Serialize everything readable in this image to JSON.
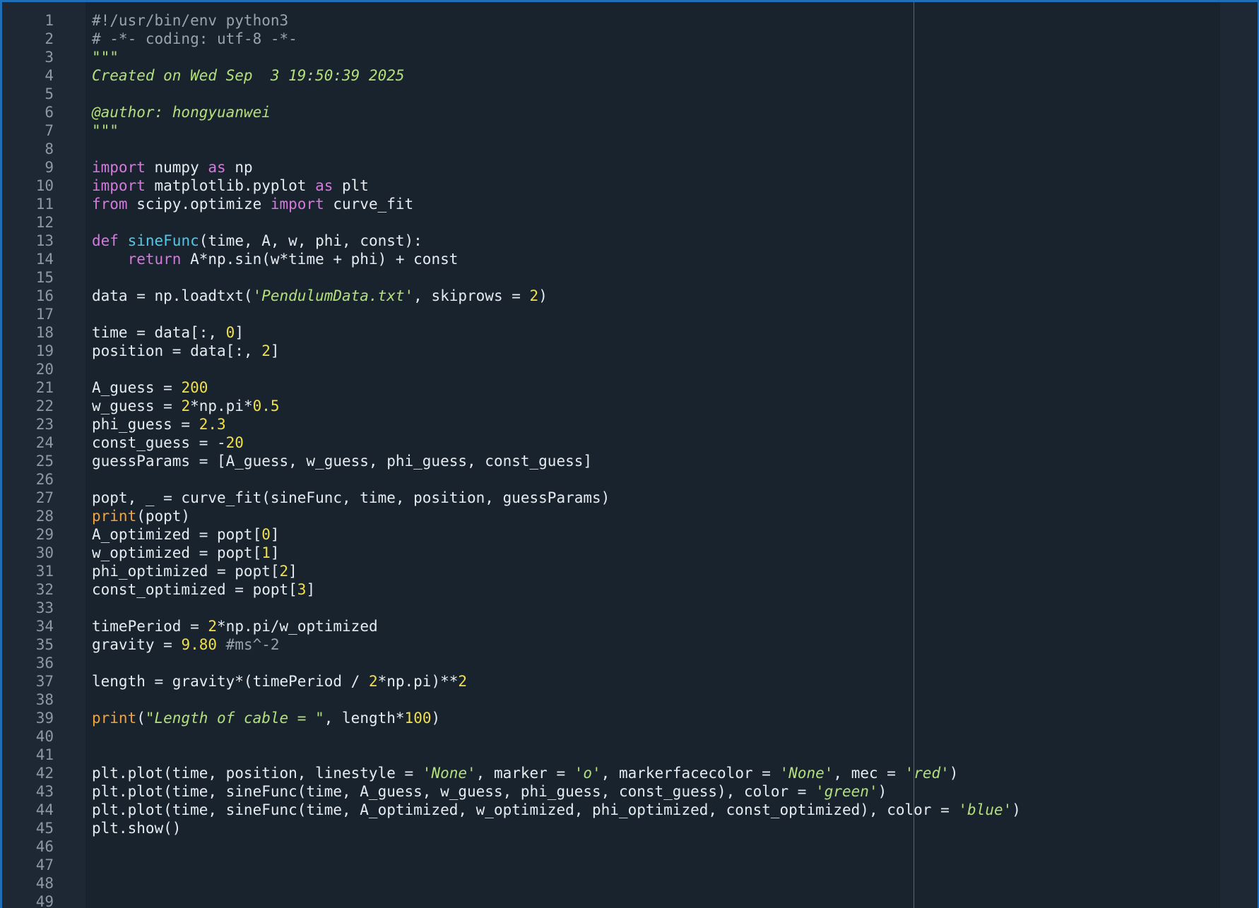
{
  "colors": {
    "background": "#19232e",
    "gutter": "#1d2834",
    "line_number": "#8e99a5",
    "text": "#e6ebf0",
    "comment": "#9aa3ad",
    "docstring": "#b3e07a",
    "keyword": "#d678dd",
    "function_name": "#52c8e8",
    "builtin": "#f4a23a",
    "number": "#f2e04b",
    "string": "#b3e07a",
    "border": "#1f6fb8",
    "edge_ruler": "#5c6670"
  },
  "lines": [
    {
      "n": "1",
      "tokens": [
        {
          "t": "comment",
          "v": "#!/usr/bin/env python3"
        }
      ]
    },
    {
      "n": "2",
      "tokens": [
        {
          "t": "comment",
          "v": "# -*- coding: utf-8 -*-"
        }
      ]
    },
    {
      "n": "3",
      "tokens": [
        {
          "t": "docstring",
          "v": "\"\"\""
        }
      ]
    },
    {
      "n": "4",
      "tokens": [
        {
          "t": "docstring",
          "v": "Created on Wed Sep  3 19:50:39 2025"
        }
      ]
    },
    {
      "n": "5",
      "tokens": []
    },
    {
      "n": "6",
      "tokens": [
        {
          "t": "docstring",
          "v": "@author: hongyuanwei"
        }
      ]
    },
    {
      "n": "7",
      "tokens": [
        {
          "t": "docstring",
          "v": "\"\"\""
        }
      ]
    },
    {
      "n": "8",
      "tokens": []
    },
    {
      "n": "9",
      "tokens": [
        {
          "t": "keyword",
          "v": "import"
        },
        {
          "t": "text",
          "v": " numpy "
        },
        {
          "t": "keyword",
          "v": "as"
        },
        {
          "t": "text",
          "v": " np"
        }
      ]
    },
    {
      "n": "10",
      "tokens": [
        {
          "t": "keyword",
          "v": "import"
        },
        {
          "t": "text",
          "v": " matplotlib.pyplot "
        },
        {
          "t": "keyword",
          "v": "as"
        },
        {
          "t": "text",
          "v": " plt"
        }
      ]
    },
    {
      "n": "11",
      "tokens": [
        {
          "t": "keyword",
          "v": "from"
        },
        {
          "t": "text",
          "v": " scipy.optimize "
        },
        {
          "t": "keyword",
          "v": "import"
        },
        {
          "t": "text",
          "v": " curve_fit"
        }
      ]
    },
    {
      "n": "12",
      "tokens": []
    },
    {
      "n": "13",
      "tokens": [
        {
          "t": "keyword",
          "v": "def"
        },
        {
          "t": "text",
          "v": " "
        },
        {
          "t": "funcname",
          "v": "sineFunc"
        },
        {
          "t": "text",
          "v": "(time, A, w, phi, const):"
        }
      ]
    },
    {
      "n": "14",
      "tokens": [
        {
          "t": "text",
          "v": "    "
        },
        {
          "t": "keyword",
          "v": "return"
        },
        {
          "t": "text",
          "v": " A*np.sin(w*time + phi) + const"
        }
      ]
    },
    {
      "n": "15",
      "tokens": []
    },
    {
      "n": "16",
      "tokens": [
        {
          "t": "text",
          "v": "data = np.loadtxt("
        },
        {
          "t": "string",
          "v": "'PendulumData.txt'"
        },
        {
          "t": "text",
          "v": ", skiprows = "
        },
        {
          "t": "number",
          "v": "2"
        },
        {
          "t": "text",
          "v": ")"
        }
      ]
    },
    {
      "n": "17",
      "tokens": []
    },
    {
      "n": "18",
      "tokens": [
        {
          "t": "text",
          "v": "time = data[:, "
        },
        {
          "t": "number",
          "v": "0"
        },
        {
          "t": "text",
          "v": "]"
        }
      ]
    },
    {
      "n": "19",
      "tokens": [
        {
          "t": "text",
          "v": "position = data[:, "
        },
        {
          "t": "number",
          "v": "2"
        },
        {
          "t": "text",
          "v": "]"
        }
      ]
    },
    {
      "n": "20",
      "tokens": []
    },
    {
      "n": "21",
      "tokens": [
        {
          "t": "text",
          "v": "A_guess = "
        },
        {
          "t": "number",
          "v": "200"
        }
      ]
    },
    {
      "n": "22",
      "tokens": [
        {
          "t": "text",
          "v": "w_guess = "
        },
        {
          "t": "number",
          "v": "2"
        },
        {
          "t": "text",
          "v": "*np.pi*"
        },
        {
          "t": "number",
          "v": "0.5"
        }
      ]
    },
    {
      "n": "23",
      "tokens": [
        {
          "t": "text",
          "v": "phi_guess = "
        },
        {
          "t": "number",
          "v": "2.3"
        }
      ]
    },
    {
      "n": "24",
      "tokens": [
        {
          "t": "text",
          "v": "const_guess = -"
        },
        {
          "t": "number",
          "v": "20"
        }
      ]
    },
    {
      "n": "25",
      "tokens": [
        {
          "t": "text",
          "v": "guessParams = [A_guess, w_guess, phi_guess, const_guess]"
        }
      ]
    },
    {
      "n": "26",
      "tokens": []
    },
    {
      "n": "27",
      "tokens": [
        {
          "t": "text",
          "v": "popt, _ = curve_fit(sineFunc, time, position, guessParams)"
        }
      ]
    },
    {
      "n": "28",
      "tokens": [
        {
          "t": "builtin",
          "v": "print"
        },
        {
          "t": "text",
          "v": "(popt)"
        }
      ]
    },
    {
      "n": "29",
      "tokens": [
        {
          "t": "text",
          "v": "A_optimized = popt["
        },
        {
          "t": "number",
          "v": "0"
        },
        {
          "t": "text",
          "v": "]"
        }
      ]
    },
    {
      "n": "30",
      "tokens": [
        {
          "t": "text",
          "v": "w_optimized = popt["
        },
        {
          "t": "number",
          "v": "1"
        },
        {
          "t": "text",
          "v": "]"
        }
      ]
    },
    {
      "n": "31",
      "tokens": [
        {
          "t": "text",
          "v": "phi_optimized = popt["
        },
        {
          "t": "number",
          "v": "2"
        },
        {
          "t": "text",
          "v": "]"
        }
      ]
    },
    {
      "n": "32",
      "tokens": [
        {
          "t": "text",
          "v": "const_optimized = popt["
        },
        {
          "t": "number",
          "v": "3"
        },
        {
          "t": "text",
          "v": "]"
        }
      ]
    },
    {
      "n": "33",
      "tokens": []
    },
    {
      "n": "34",
      "tokens": [
        {
          "t": "text",
          "v": "timePeriod = "
        },
        {
          "t": "number",
          "v": "2"
        },
        {
          "t": "text",
          "v": "*np.pi/w_optimized"
        }
      ]
    },
    {
      "n": "35",
      "tokens": [
        {
          "t": "text",
          "v": "gravity = "
        },
        {
          "t": "number",
          "v": "9.80"
        },
        {
          "t": "text",
          "v": " "
        },
        {
          "t": "comment",
          "v": "#ms^-2"
        }
      ]
    },
    {
      "n": "36",
      "tokens": []
    },
    {
      "n": "37",
      "tokens": [
        {
          "t": "text",
          "v": "length = gravity*(timePeriod / "
        },
        {
          "t": "number",
          "v": "2"
        },
        {
          "t": "text",
          "v": "*np.pi)**"
        },
        {
          "t": "number",
          "v": "2"
        }
      ]
    },
    {
      "n": "38",
      "tokens": []
    },
    {
      "n": "39",
      "tokens": [
        {
          "t": "builtin",
          "v": "print"
        },
        {
          "t": "text",
          "v": "("
        },
        {
          "t": "string",
          "v": "\"Length of cable = \""
        },
        {
          "t": "text",
          "v": ", length*"
        },
        {
          "t": "number",
          "v": "100"
        },
        {
          "t": "text",
          "v": ")"
        }
      ]
    },
    {
      "n": "40",
      "tokens": []
    },
    {
      "n": "41",
      "tokens": []
    },
    {
      "n": "42",
      "tokens": [
        {
          "t": "text",
          "v": "plt.plot(time, position, linestyle = "
        },
        {
          "t": "string",
          "v": "'None'"
        },
        {
          "t": "text",
          "v": ", marker = "
        },
        {
          "t": "string",
          "v": "'o'"
        },
        {
          "t": "text",
          "v": ", markerfacecolor = "
        },
        {
          "t": "string",
          "v": "'None'"
        },
        {
          "t": "text",
          "v": ", mec = "
        },
        {
          "t": "string",
          "v": "'red'"
        },
        {
          "t": "text",
          "v": ")"
        }
      ]
    },
    {
      "n": "43",
      "tokens": [
        {
          "t": "text",
          "v": "plt.plot(time, sineFunc(time, A_guess, w_guess, phi_guess, const_guess), color = "
        },
        {
          "t": "string",
          "v": "'green'"
        },
        {
          "t": "text",
          "v": ")"
        }
      ]
    },
    {
      "n": "44",
      "tokens": [
        {
          "t": "text",
          "v": "plt.plot(time, sineFunc(time, A_optimized, w_optimized, phi_optimized, const_optimized), color = "
        },
        {
          "t": "string",
          "v": "'blue'"
        },
        {
          "t": "text",
          "v": ")"
        }
      ]
    },
    {
      "n": "45",
      "tokens": [
        {
          "t": "text",
          "v": "plt.show()"
        }
      ]
    },
    {
      "n": "46",
      "tokens": []
    },
    {
      "n": "47",
      "tokens": []
    },
    {
      "n": "48",
      "tokens": []
    },
    {
      "n": "49",
      "tokens": []
    }
  ]
}
